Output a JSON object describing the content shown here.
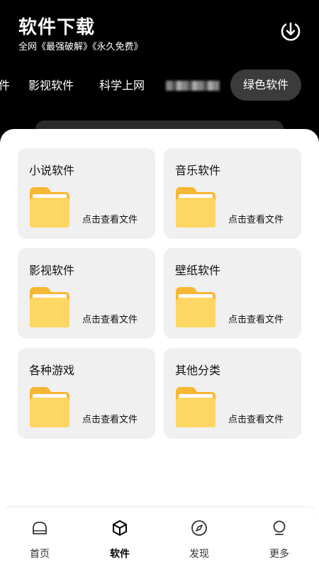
{
  "header": {
    "title": "软件下载",
    "subtitle": "全网《最强破解》《永久免费》",
    "download_icon": "download-icon"
  },
  "tabs": {
    "items": [
      {
        "label": "件"
      },
      {
        "label": "影视软件"
      },
      {
        "label": "科学上网"
      }
    ],
    "active": {
      "label": "绿色软件"
    }
  },
  "cards": [
    {
      "title": "小说软件",
      "hint": "点击查看文件",
      "icon": "folder-icon"
    },
    {
      "title": "音乐软件",
      "hint": "点击查看文件",
      "icon": "folder-icon"
    },
    {
      "title": "影视软件",
      "hint": "点击查看文件",
      "icon": "folder-icon"
    },
    {
      "title": "壁纸软件",
      "hint": "点击查看文件",
      "icon": "folder-icon"
    },
    {
      "title": "各种游戏",
      "hint": "点击查看文件",
      "icon": "folder-icon"
    },
    {
      "title": "其他分类",
      "hint": "点击查看文件",
      "icon": "folder-icon"
    }
  ],
  "bottom_nav": {
    "items": [
      {
        "label": "首页",
        "icon": "home-icon"
      },
      {
        "label": "软件",
        "icon": "box-icon"
      },
      {
        "label": "发现",
        "icon": "compass-icon"
      },
      {
        "label": "更多",
        "icon": "bulb-icon"
      }
    ],
    "active_index": 1
  },
  "colors": {
    "background": "#000000",
    "sheet": "#ffffff",
    "card": "#f0f0f0",
    "folder_front": "#fdd663",
    "folder_back": "#f7b733",
    "active_tab": "#3b3b3b"
  }
}
